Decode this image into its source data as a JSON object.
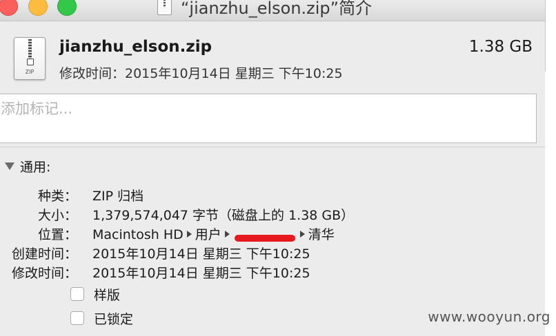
{
  "window": {
    "title": "“jianzhu_elson.zip”简介",
    "buttons": {
      "close": "close",
      "minimize": "minimize",
      "zoom": "zoom"
    }
  },
  "header": {
    "icon_label": "ZIP",
    "file_name": "jianzhu_elson.zip",
    "file_size": "1.38 GB",
    "modified": "修改时间：2015年10月14日 星期三 下午10:25"
  },
  "tags": {
    "placeholder": "添加标记..."
  },
  "general": {
    "title": "通用:",
    "kind_label": "种类：",
    "kind_value": "ZIP 归档",
    "size_label": "大小：",
    "size_value": "1,379,574,047 字节（磁盘上的 1.38 GB）",
    "where_label": "位置：",
    "where_path": [
      "Macintosh HD",
      "用户",
      "清华"
    ],
    "created_label": "创建时间：",
    "created_value": "2015年10月14日 星期三 下午10:25",
    "modified_label": "修改时间：",
    "modified_value": "2015年10月14日 星期三 下午10:25",
    "stationery_label": "样版",
    "locked_label": "已锁定"
  },
  "watermark": "www.wooyun.org",
  "colors": {
    "close": "#fc605c",
    "minimize": "#fdbc40",
    "zoom": "#34c84a",
    "redaction": "#e8191e",
    "window_bg": "#ececec"
  }
}
